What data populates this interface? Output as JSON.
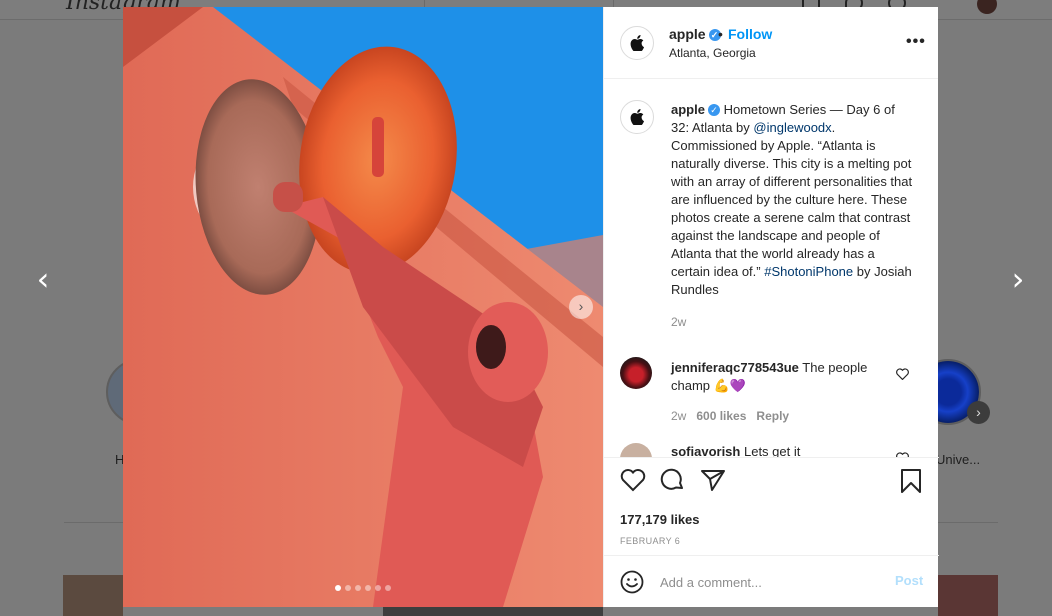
{
  "background": {
    "logo_text": "Instagram",
    "story_left_label": "H",
    "story_right_label": "Unive..."
  },
  "post": {
    "username": "apple",
    "verified": true,
    "dot": "•",
    "follow_label": "Follow",
    "location": "Atlanta, Georgia",
    "more_label": "•••",
    "caption": {
      "user": "apple",
      "part1": "Hometown Series — Day 6 of 32: Atlanta by ",
      "mention": "@inglewoodx",
      "part2": ". Commissioned by Apple. “Atlanta is naturally diverse. This city is a melting pot with an array of different personalities that are influenced by the culture here. These photos create a serene calm that contrast against the landscape and people of Atlanta that the world already has a certain idea of.” ",
      "hashtag": "#ShotoniPhone",
      "part3": " by Josiah Rundles",
      "age": "2w"
    },
    "comments": [
      {
        "user": "jenniferaqc778543ue",
        "text": "The people champ 💪💜",
        "age": "2w",
        "likes": "600 likes",
        "reply": "Reply"
      },
      {
        "user": "sofiavorish",
        "text": "Lets get it"
      }
    ],
    "likes_text": "177,179 likes",
    "date": "FEBRUARY 6",
    "comment_placeholder": "Add a comment...",
    "post_label": "Post",
    "carousel_count": 6,
    "carousel_active": 0
  },
  "icons": {
    "prev": "chevron-left-icon",
    "next": "chevron-right-icon",
    "like": "heart-icon",
    "comment": "comment-icon",
    "share": "paper-plane-icon",
    "save": "bookmark-icon",
    "emoji": "smiley-icon"
  },
  "colors": {
    "accent": "#0095f6",
    "verified": "#3897f0",
    "post_disabled": "#b2dffc"
  }
}
